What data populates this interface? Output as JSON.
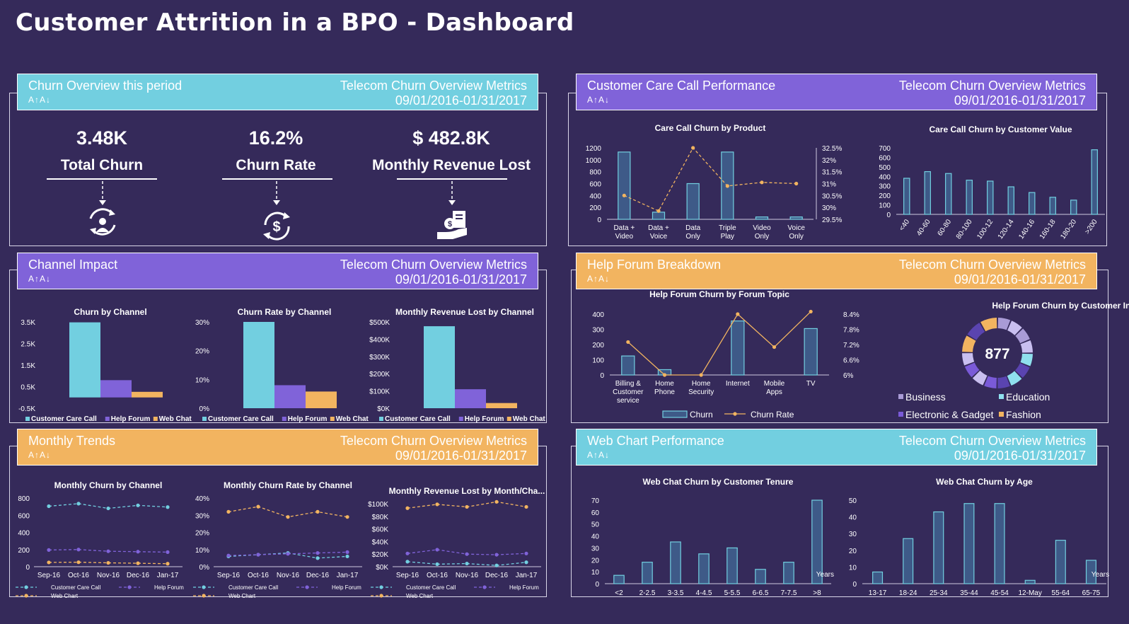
{
  "title": "Customer Attrition in a BPO - Dashboard",
  "subtitle": "Telecom Churn Overview Metrics",
  "period": "09/01/2016-01/31/2017",
  "font_icons": "A↑A↓",
  "colors": {
    "teal": "#72cfe0",
    "purple": "#8063d9",
    "orange": "#f2b460",
    "bg": "#352a5a",
    "bar": "#3e5a88"
  },
  "panels": {
    "churn_overview": "Churn Overview this period",
    "care_call": "Customer Care Call Performance",
    "channel_impact": "Channel Impact",
    "help_forum": "Help Forum Breakdown",
    "monthly_trends": "Monthly Trends",
    "web_chat": "Web Chart Performance"
  },
  "kpis": [
    {
      "value": "3.48K",
      "label": "Total Churn",
      "icon": "user-cycle-icon"
    },
    {
      "value": "16.2%",
      "label": "Churn Rate",
      "icon": "dollar-cycle-icon"
    },
    {
      "value": "$ 482.8K",
      "label": "Monthly Revenue Lost",
      "icon": "money-hand-icon"
    }
  ],
  "chart_data": [
    {
      "id": "care_product",
      "type": "bar+line",
      "title": "Care Call Churn by Product",
      "categories": [
        "Data + Video",
        "Data + Voice",
        "Data Only",
        "Triple Play",
        "Video Only",
        "Voice Only"
      ],
      "bars": [
        1130,
        120,
        600,
        1130,
        40,
        40
      ],
      "ylim": [
        0,
        1200
      ],
      "yticks": [
        "0",
        "200",
        "400",
        "600",
        "800",
        "1000",
        "1200"
      ],
      "line": [
        30.5,
        29.85,
        32.5,
        30.9,
        31.05,
        31.0
      ],
      "y2lim": [
        29.5,
        32.5
      ],
      "y2ticks": [
        "29.5%",
        "30%",
        "30.5%",
        "31%",
        "31.5%",
        "32%",
        "32.5%"
      ]
    },
    {
      "id": "care_value",
      "type": "bar",
      "title": "Care Call Churn by Customer Value",
      "categories": [
        "<40",
        "40-60",
        "60-80",
        "80-100",
        "100-12",
        "120-14",
        "140-16",
        "160-18",
        "180-20",
        ">200"
      ],
      "values": [
        380,
        450,
        430,
        360,
        350,
        290,
        230,
        180,
        150,
        680
      ],
      "ylim": [
        0,
        700
      ],
      "yticks": [
        "0",
        "100",
        "200",
        "300",
        "400",
        "500",
        "600",
        "700"
      ]
    },
    {
      "id": "churn_by_channel",
      "type": "bar",
      "title": "Churn by Channel",
      "series": [
        {
          "name": "Customer Care Call",
          "value": 3480
        },
        {
          "name": "Help Forum",
          "value": 800
        },
        {
          "name": "Web Chat",
          "value": 260
        }
      ],
      "ylim": [
        -500,
        3500
      ],
      "yticks": [
        "-0.5K",
        "0.5K",
        "1.5K",
        "2.5K",
        "3.5K"
      ]
    },
    {
      "id": "rate_by_channel",
      "type": "bar",
      "title": "Churn Rate by Channel",
      "series": [
        {
          "name": "Customer Care Call",
          "value": 30
        },
        {
          "name": "Help Forum",
          "value": 8
        },
        {
          "name": "Web Chat",
          "value": 5.8
        }
      ],
      "ylim": [
        0,
        30
      ],
      "yticks": [
        "0%",
        "10%",
        "20%",
        "30%"
      ]
    },
    {
      "id": "revenue_by_channel",
      "type": "bar",
      "title": "Monthly Revenue Lost by Channel",
      "series": [
        {
          "name": "Customer Care Call",
          "value": 475
        },
        {
          "name": "Help Forum",
          "value": 110
        },
        {
          "name": "Web Chat",
          "value": 30
        }
      ],
      "ylim": [
        0,
        500
      ],
      "yticks": [
        "$0K",
        "$100K",
        "$200K",
        "$300K",
        "$400K",
        "$500K"
      ]
    },
    {
      "id": "forum_topic",
      "type": "bar+line",
      "title": "Help Forum Churn by Forum Topic",
      "categories": [
        "Billing & Customer service",
        "Home Phone",
        "Home Security",
        "Internet",
        "Mobile Apps",
        "TV"
      ],
      "bars": [
        125,
        35,
        0,
        355,
        0,
        305
      ],
      "ylim": [
        0,
        400
      ],
      "yticks": [
        "0",
        "100",
        "200",
        "300",
        "400"
      ],
      "line": [
        7.3,
        6.0,
        6.0,
        8.4,
        7.1,
        8.5
      ],
      "y2lim": [
        6.0,
        8.4
      ],
      "y2ticks": [
        "6%",
        "6.6%",
        "7.2%",
        "7.8%",
        "8.4%"
      ],
      "legend": [
        "Churn",
        "Churn Rate"
      ]
    },
    {
      "id": "forum_interests",
      "type": "pie",
      "title": "Help Forum Churn by Customer Interests",
      "total": "877",
      "slices": [
        {
          "name": "Business",
          "value": 220,
          "color": "#a99bd6"
        },
        {
          "name": "Education",
          "value": 220,
          "color": "#8fe0ee"
        },
        {
          "name": "Electronic & Gadget",
          "value": 220,
          "color": "#7a5ad8"
        },
        {
          "name": "Fashion",
          "value": 217,
          "color": "#f2b460"
        }
      ]
    },
    {
      "id": "monthly_churn",
      "type": "line",
      "title": "Monthly Churn by Channel",
      "x": [
        "Sep-16",
        "Oct-16",
        "Nov-16",
        "Dec-16",
        "Jan-17"
      ],
      "series": [
        {
          "name": "Customer Care Call",
          "values": [
            705,
            735,
            680,
            715,
            695
          ]
        },
        {
          "name": "Help Forum",
          "values": [
            195,
            200,
            180,
            175,
            170
          ]
        },
        {
          "name": "Web Chart",
          "values": [
            50,
            52,
            45,
            40,
            35
          ]
        }
      ],
      "ylim": [
        0,
        800
      ],
      "yticks": [
        "0",
        "200",
        "400",
        "600",
        "800"
      ]
    },
    {
      "id": "monthly_rate",
      "type": "line",
      "title": "Monthly Churn Rate by Channel",
      "x": [
        "Sep-16",
        "Oct-16",
        "Nov-16",
        "Dec-16",
        "Jan-17"
      ],
      "series": [
        {
          "name": "Customer Care Call",
          "values": [
            6,
            7,
            8,
            5,
            6
          ]
        },
        {
          "name": "Help Forum",
          "values": [
            6.5,
            7,
            7.5,
            8,
            8.5
          ]
        },
        {
          "name": "Web Chart",
          "values": [
            32,
            35,
            29,
            32,
            29
          ]
        }
      ],
      "ylim": [
        0,
        40
      ],
      "yticks": [
        "0%",
        "10%",
        "20%",
        "30%",
        "40%"
      ]
    },
    {
      "id": "monthly_revenue",
      "type": "line",
      "title": "Monthly Revenue Lost by Month/Cha...",
      "x": [
        "Sep-16",
        "Oct-16",
        "Nov-16",
        "Dec-16",
        "Jan-17"
      ],
      "series": [
        {
          "name": "Customer Care Call",
          "values": [
            8,
            4,
            5,
            2,
            7
          ]
        },
        {
          "name": "Help Forum",
          "values": [
            21,
            27,
            20,
            19,
            21
          ]
        },
        {
          "name": "Web Chart",
          "values": [
            93,
            99,
            95,
            103,
            95
          ]
        }
      ],
      "ylim": [
        0,
        100
      ],
      "yticks": [
        "$0K",
        "$20K",
        "$40K",
        "$60K",
        "$80K",
        "$100K"
      ]
    },
    {
      "id": "webchat_tenure",
      "type": "bar",
      "title": "Web Chat Churn by Customer Tenure",
      "categories": [
        "<2",
        "2-2.5",
        "3-3.5",
        "4-4.5",
        "5-5.5",
        "6-6.5",
        "7-7.5",
        ">8"
      ],
      "values": [
        7,
        18,
        35,
        25,
        30,
        12,
        18,
        70
      ],
      "ylim": [
        0,
        70
      ],
      "yticks": [
        "0",
        "10",
        "20",
        "30",
        "40",
        "50",
        "60",
        "70"
      ],
      "unit": "Years"
    },
    {
      "id": "webchat_age",
      "type": "bar",
      "title": "Web Chat Churn by Age",
      "categories": [
        "13-17",
        "18-24",
        "25-34",
        "35-44",
        "45-54",
        "12-May",
        "55-64",
        "65-75"
      ],
      "values": [
        7,
        27,
        43,
        48,
        48,
        2,
        26,
        14
      ],
      "ylim": [
        0,
        50
      ],
      "yticks": [
        "0",
        "10",
        "20",
        "30",
        "40",
        "50"
      ],
      "unit": "Years"
    }
  ],
  "channel_legend": [
    "Customer Care Call",
    "Help Forum",
    "Web Chat"
  ],
  "trend_legend": [
    "Customer Care Call",
    "Help Forum",
    "Web Chart"
  ]
}
